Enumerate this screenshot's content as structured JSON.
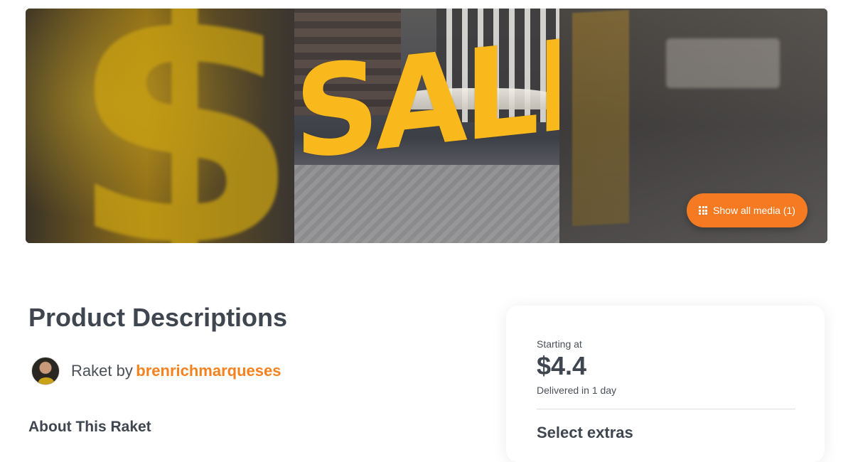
{
  "hero": {
    "banner_text": "SALE",
    "background_letter": "$",
    "media_button_label": "Show all media (1)"
  },
  "product": {
    "title": "Product Descriptions",
    "byline_prefix": "Raket by",
    "seller_name": "brenrichmarqueses",
    "about_heading": "About This Raket"
  },
  "pricing": {
    "starting_label": "Starting at",
    "price": "$4.4",
    "delivery": "Delivered in 1 day",
    "extras_heading": "Select extras"
  },
  "colors": {
    "accent": "#f57a22",
    "heading": "#3f4650",
    "sale_yellow": "#f9b81b"
  }
}
